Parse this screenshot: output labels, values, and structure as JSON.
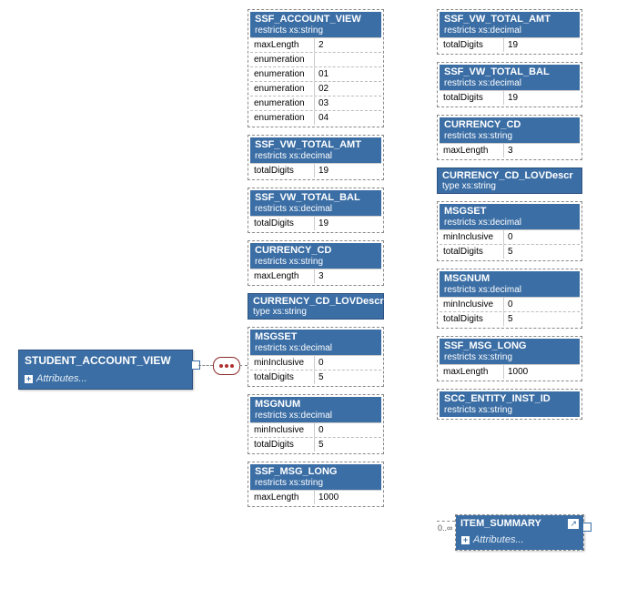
{
  "root": {
    "title": "STUDENT_ACCOUNT_VIEW",
    "attrs": "Attributes..."
  },
  "item_summary": {
    "title": "ITEM_SUMMARY",
    "attrs": "Attributes...",
    "occurs": "0..∞"
  },
  "col1": [
    {
      "title": "SSF_ACCOUNT_VIEW",
      "sub": "restricts xs:string",
      "facets": [
        [
          "maxLength",
          "2"
        ],
        [
          "enumeration",
          ""
        ],
        [
          "enumeration",
          "01"
        ],
        [
          "enumeration",
          "02"
        ],
        [
          "enumeration",
          "03"
        ],
        [
          "enumeration",
          "04"
        ]
      ]
    },
    {
      "title": "SSF_VW_TOTAL_AMT",
      "sub": "restricts xs:decimal",
      "facets": [
        [
          "totalDigits",
          "19"
        ]
      ]
    },
    {
      "title": "SSF_VW_TOTAL_BAL",
      "sub": "restricts xs:decimal",
      "facets": [
        [
          "totalDigits",
          "19"
        ]
      ]
    },
    {
      "title": "CURRENCY_CD",
      "sub": "restricts xs:string",
      "facets": [
        [
          "maxLength",
          "3"
        ]
      ]
    },
    {
      "title": "CURRENCY_CD_LOVDescr",
      "sub": "type xs:string",
      "simple": true
    },
    {
      "title": "MSGSET",
      "sub": "restricts xs:decimal",
      "facets": [
        [
          "minInclusive",
          "0"
        ],
        [
          "totalDigits",
          "5"
        ]
      ]
    },
    {
      "title": "MSGNUM",
      "sub": "restricts xs:decimal",
      "facets": [
        [
          "minInclusive",
          "0"
        ],
        [
          "totalDigits",
          "5"
        ]
      ]
    },
    {
      "title": "SSF_MSG_LONG",
      "sub": "restricts xs:string",
      "facets": [
        [
          "maxLength",
          "1000"
        ]
      ]
    }
  ],
  "col2": [
    {
      "title": "SSF_VW_TOTAL_AMT",
      "sub": "restricts xs:decimal",
      "facets": [
        [
          "totalDigits",
          "19"
        ]
      ]
    },
    {
      "title": "SSF_VW_TOTAL_BAL",
      "sub": "restricts xs:decimal",
      "facets": [
        [
          "totalDigits",
          "19"
        ]
      ]
    },
    {
      "title": "CURRENCY_CD",
      "sub": "restricts xs:string",
      "facets": [
        [
          "maxLength",
          "3"
        ]
      ]
    },
    {
      "title": "CURRENCY_CD_LOVDescr",
      "sub": "type xs:string",
      "simple": true
    },
    {
      "title": "MSGSET",
      "sub": "restricts xs:decimal",
      "facets": [
        [
          "minInclusive",
          "0"
        ],
        [
          "totalDigits",
          "5"
        ]
      ]
    },
    {
      "title": "MSGNUM",
      "sub": "restricts xs:decimal",
      "facets": [
        [
          "minInclusive",
          "0"
        ],
        [
          "totalDigits",
          "5"
        ]
      ]
    },
    {
      "title": "SSF_MSG_LONG",
      "sub": "restricts xs:string",
      "facets": [
        [
          "maxLength",
          "1000"
        ]
      ]
    },
    {
      "title": "SCC_ENTITY_INST_ID",
      "sub": "restricts xs:string",
      "facets": []
    }
  ]
}
